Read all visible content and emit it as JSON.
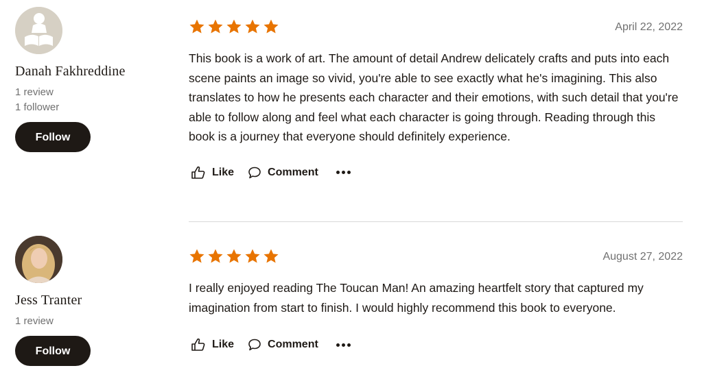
{
  "accent_color": "#e87400",
  "button_color": "#1e1915",
  "reviews": [
    {
      "reviewer": {
        "name": "Danah Fakhreddine",
        "stats": [
          "1 review",
          "1 follower"
        ],
        "follow_label": "Follow",
        "avatar": "default-reader-avatar"
      },
      "rating": 5,
      "date": "April 22, 2022",
      "text": "This book is a work of art. The amount of detail Andrew delicately crafts and puts into each scene paints an image so vivid, you're able to see exactly what he's imagining. This also translates to how he presents each character and their emotions, with such detail that you're able to follow along and feel what each character is going through. Reading through this book is a journey that everyone should definitely experience.",
      "actions": {
        "like": "Like",
        "comment": "Comment",
        "more": "more-icon"
      }
    },
    {
      "reviewer": {
        "name": "Jess Tranter",
        "stats": [
          "1 review"
        ],
        "follow_label": "Follow",
        "avatar": "profile-photo"
      },
      "rating": 5,
      "date": "August 27, 2022",
      "text": "I really enjoyed reading The Toucan Man! An amazing heartfelt story that captured my imagination from start to finish. I would highly recommend this book to everyone.",
      "actions": {
        "like": "Like",
        "comment": "Comment",
        "more": "more-icon"
      }
    }
  ]
}
